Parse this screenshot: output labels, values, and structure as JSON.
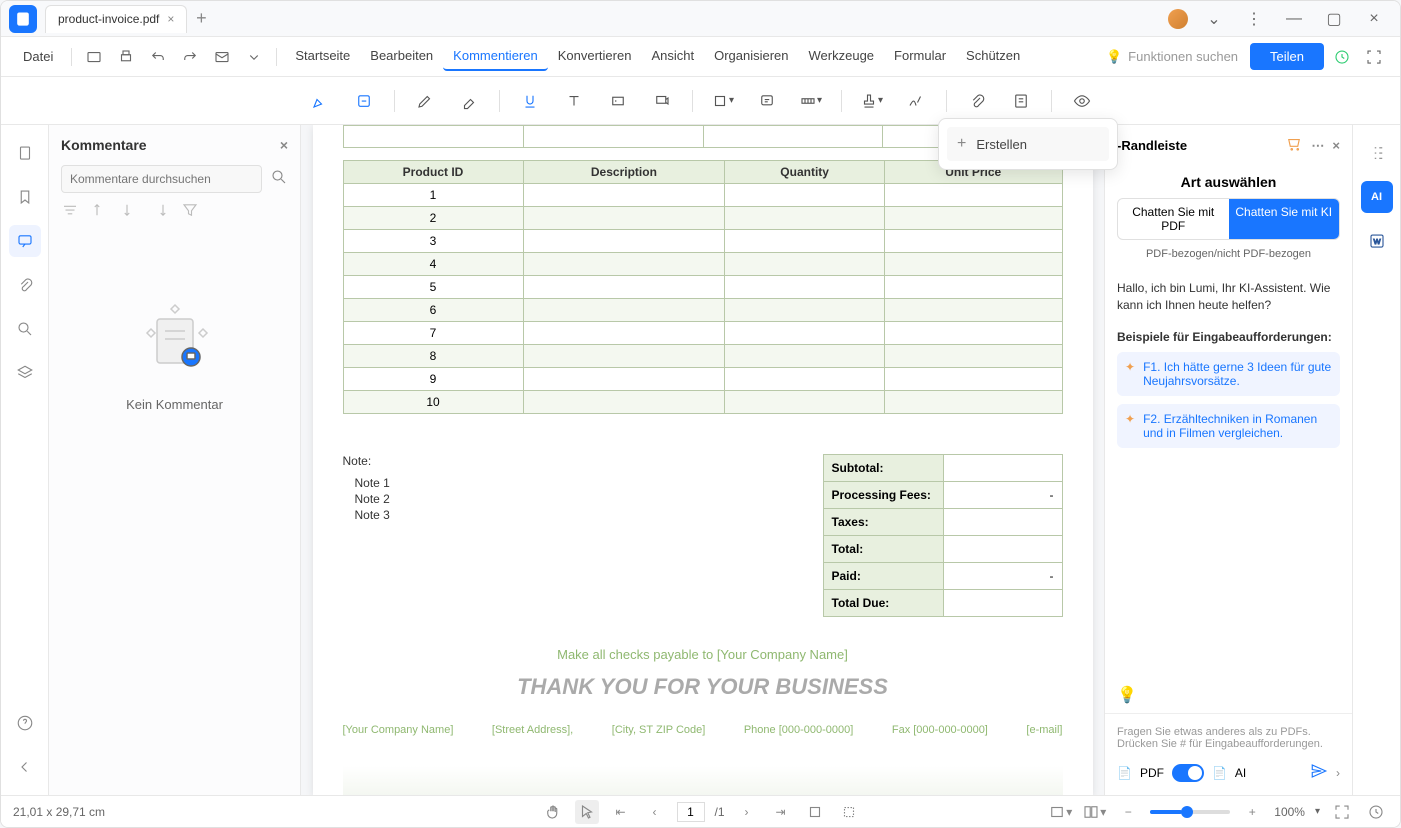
{
  "tab": {
    "title": "product-invoice.pdf"
  },
  "menu": {
    "file": "Datei",
    "items": [
      "Startseite",
      "Bearbeiten",
      "Kommentieren",
      "Konvertieren",
      "Ansicht",
      "Organisieren",
      "Werkzeuge",
      "Formular",
      "Schützen"
    ],
    "activeIndex": 2,
    "search": "Funktionen suchen",
    "share": "Teilen"
  },
  "comments": {
    "title": "Kommentare",
    "searchPlaceholder": "Kommentare durchsuchen",
    "empty": "Kein Kommentar"
  },
  "popup": {
    "create": "Erstellen"
  },
  "invoice": {
    "headers": [
      "Product ID",
      "Description",
      "Quantity",
      "Unit Price"
    ],
    "rows": [
      "1",
      "2",
      "3",
      "4",
      "5",
      "6",
      "7",
      "8",
      "9",
      "10"
    ],
    "notesLabel": "Note:",
    "notes": [
      "Note 1",
      "Note 2",
      "Note 3"
    ],
    "totals": {
      "subtotal": {
        "label": "Subtotal:",
        "value": ""
      },
      "processing": {
        "label": "Processing Fees:",
        "value": "-"
      },
      "taxes": {
        "label": "Taxes:",
        "value": ""
      },
      "total": {
        "label": "Total:",
        "value": ""
      },
      "paid": {
        "label": "Paid:",
        "value": "-"
      },
      "due": {
        "label": "Total Due:",
        "value": ""
      }
    },
    "checks": "Make all checks payable to [Your Company Name]",
    "thanks": "THANK YOU FOR YOUR BUSINESS",
    "footer": [
      "[Your Company Name]",
      "[Street Address],",
      "[City, ST ZIP Code]",
      "Phone [000-000-0000]",
      "Fax [000-000-0000]",
      "[e-mail]"
    ]
  },
  "ai": {
    "headerTitle": "-Randleiste",
    "chooseType": "Art auswählen",
    "tabs": [
      "Chatten Sie mit PDF",
      "Chatten Sie mit KI"
    ],
    "sub": "PDF-bezogen/nicht PDF-bezogen",
    "greeting": "Hallo, ich bin Lumi, Ihr KI-Assistent. Wie kann ich Ihnen heute helfen?",
    "examplesTitle": "Beispiele für Eingabeaufforderungen:",
    "examples": [
      "F1. Ich hätte gerne 3 Ideen für gute Neujahrsvorsätze.",
      "F2. Erzähltechniken in Romanen und in Filmen vergleichen."
    ],
    "hint": "Fragen Sie etwas anderes als zu PDFs. Drücken Sie # für Eingabeaufforderungen.",
    "pdfLabel": "PDF",
    "aiLabel": "AI"
  },
  "status": {
    "dimensions": "21,01 x 29,71 cm",
    "page": "1",
    "pageTotal": "/1",
    "zoom": "100%"
  }
}
